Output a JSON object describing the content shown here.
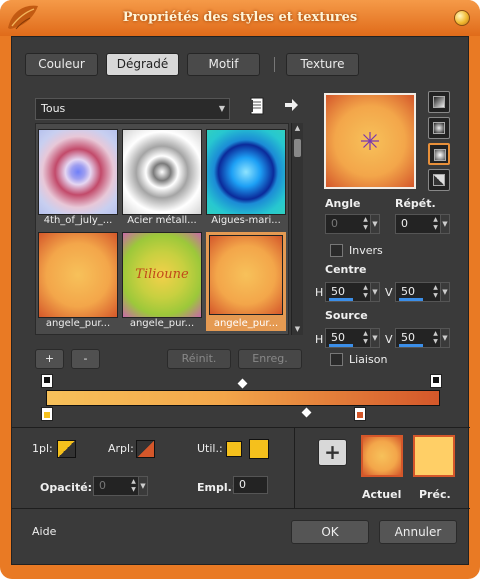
{
  "window": {
    "title": "Propriétés des styles et textures"
  },
  "tabs": [
    {
      "label": "Couleur",
      "selected": false
    },
    {
      "label": "Dégradé",
      "selected": true
    },
    {
      "label": "Motif",
      "selected": false
    },
    {
      "label": "Texture",
      "selected": false
    }
  ],
  "category": {
    "value": "Tous"
  },
  "gallery": {
    "items": [
      {
        "caption": "4th_of_july_...",
        "selected": false
      },
      {
        "caption": "Acier métall...",
        "selected": false
      },
      {
        "caption": "Aigues-mari...",
        "selected": false
      },
      {
        "caption": "angele_pur...",
        "selected": false
      },
      {
        "caption": "angele_pur...",
        "selected": false
      },
      {
        "caption": "angele_pur...",
        "selected": true
      }
    ],
    "thumb_signature": "Tilioune"
  },
  "buttons": {
    "add": "+",
    "remove": "-",
    "reset": "Réinit.",
    "save": "Enreg.",
    "ok": "OK",
    "cancel": "Annuler",
    "help": "Aide",
    "add_to_swatches": "+"
  },
  "settings": {
    "angle_label": "Angle",
    "angle_value": "0",
    "repeat_label": "Répét.",
    "repeat_value": "0",
    "invert_label": "Invers",
    "invert_checked": false,
    "center_label": "Centre",
    "center_h_label": "H",
    "center_h_value": "50",
    "center_v_label": "V",
    "center_v_value": "50",
    "source_label": "Source",
    "source_h_label": "H",
    "source_h_value": "50",
    "source_v_label": "V",
    "source_v_value": "50",
    "link_label": "Liaison",
    "link_checked": false
  },
  "editor": {
    "one_pl_label": "1pl:",
    "arpl_label": "Arpl:",
    "util_label": "Util.:",
    "opacity_label": "Opacité:",
    "opacity_value": "0",
    "empl_label": "Empl.:",
    "empl_value": "0"
  },
  "preview": {
    "current_label": "Actuel",
    "previous_label": "Préc."
  },
  "colors": {
    "accent": "#e8903a",
    "gradient_start": "#f7c15a",
    "gradient_end": "#d4572a",
    "util_color_1": "#f5c01c",
    "util_color_2": "#f5c01c",
    "prev_swatch": "#ffcf66"
  },
  "icons": [
    "leaf-icon",
    "window-orb-icon",
    "dropdown-arrow-icon",
    "gradient-file-icon",
    "arrow-right-icon",
    "scroll-up-icon",
    "scroll-down-icon",
    "linear-style-icon",
    "rectangular-style-icon",
    "sunburst-style-icon",
    "radial-style-icon",
    "center-crosshair-icon",
    "plus-icon"
  ]
}
